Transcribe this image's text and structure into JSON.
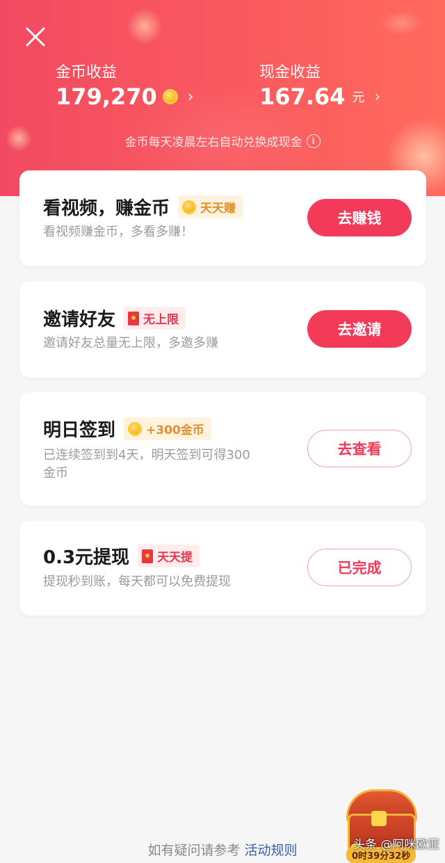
{
  "header": {
    "gold": {
      "label": "金币收益",
      "value": "179,270",
      "coin_icon": "gold-coin-icon"
    },
    "cash": {
      "label": "现金收益",
      "value": "167.64",
      "unit": "元"
    },
    "chevron": "›",
    "note": "金币每天凌晨左右自动兑换成现金",
    "info_icon": "i"
  },
  "tasks": [
    {
      "title": "看视频，赚金币",
      "badge": "天天赚",
      "badge_icon": "gold-coin-icon",
      "subtitle": "看视频赚金币，多看多赚！",
      "button": "去赚钱",
      "button_style": "primary"
    },
    {
      "title": "邀请好友",
      "badge": "无上限",
      "badge_icon": "red-envelope-icon",
      "subtitle": "邀请好友总量无上限，多邀多赚",
      "button": "去邀请",
      "button_style": "primary"
    },
    {
      "title": "明日签到",
      "badge": "+300金币",
      "badge_icon": "gold-coin-icon",
      "subtitle_line1": "已连续签到到4天，明天签到可得300",
      "subtitle_line2": "金币",
      "button": "去查看",
      "button_style": "outline"
    },
    {
      "title": "0.3元提现",
      "badge": "天天提",
      "badge_icon": "red-envelope-icon",
      "subtitle": "提现秒到账，每天都可以免费提现",
      "button": "已完成",
      "button_style": "outline"
    }
  ],
  "footer": {
    "text": "如有疑问请参考",
    "link": "活动规则"
  },
  "treasure": {
    "timer": "0时39分32秒"
  },
  "watermark": "头条 @阿咪欧亚",
  "colors": {
    "accent": "#f33a59",
    "hero_start": "#f24a62",
    "hero_end": "#ff6a5c",
    "badge_gold": "#e2902b"
  }
}
